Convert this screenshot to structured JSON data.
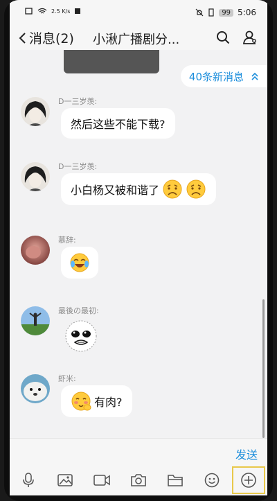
{
  "status_bar": {
    "network_speed": "2.5 K/s",
    "battery": "99",
    "time": "5:06"
  },
  "header": {
    "back_label": "消息(2)",
    "title": "小湫广播剧分..."
  },
  "chat": {
    "new_messages_label": "40条新消息",
    "messages": [
      {
        "sender": "D一三岁羡:",
        "text": "然后这些不能下载?",
        "emojis": []
      },
      {
        "sender": "D一三岁羡:",
        "text": "小白杨又被和谐了",
        "emojis": [
          "sad-face",
          "sad-face"
        ]
      },
      {
        "sender": "慕辞:",
        "text": "",
        "emojis": [
          "tears-of-joy"
        ]
      },
      {
        "sender": "最後の最初:",
        "text": "",
        "emojis": [
          "sticker-crying-face"
        ]
      },
      {
        "sender": "虾米:",
        "text": "有肉?",
        "emojis": [
          "shy-face"
        ]
      }
    ]
  },
  "input": {
    "send_label": "发送"
  },
  "toolbar": {
    "icons": [
      "microphone-icon",
      "image-icon",
      "video-icon",
      "camera-icon",
      "folder-icon",
      "emoji-icon",
      "plus-icon"
    ]
  }
}
